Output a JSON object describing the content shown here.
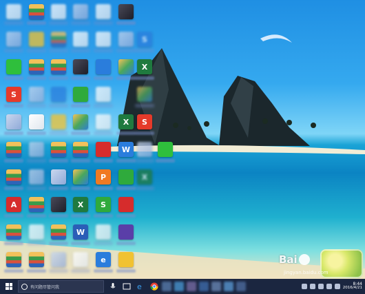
{
  "desktop": {
    "icons": [
      {
        "name": "doc-icon",
        "glyph": "",
        "style": "t-doc",
        "blur": true
      },
      {
        "name": "archive-icon",
        "glyph": "",
        "style": "t-rar",
        "blur": false
      },
      {
        "name": "document-icon",
        "glyph": "",
        "style": "t-doc",
        "blur": true
      },
      {
        "name": "chart-doc-icon",
        "glyph": "",
        "style": "t-pale",
        "blur": true
      },
      {
        "name": "file-icon",
        "glyph": "",
        "style": "t-doc",
        "blur": true
      },
      {
        "name": "dark-app-icon",
        "glyph": "",
        "style": "t-dark",
        "blur": false
      },
      {
        "name": "folder-icon",
        "glyph": "",
        "style": "t-pale",
        "blur": true
      },
      {
        "name": "document-icon",
        "glyph": "",
        "style": "t-yellow",
        "blur": true
      },
      {
        "name": "archive-icon",
        "glyph": "",
        "style": "t-rar",
        "blur": true
      },
      {
        "name": "document-icon",
        "glyph": "",
        "style": "t-doc",
        "blur": true
      },
      {
        "name": "document-icon",
        "glyph": "",
        "style": "t-doc",
        "blur": true
      },
      {
        "name": "app-icon",
        "glyph": "",
        "style": "t-pale",
        "blur": true
      },
      {
        "name": "app-icon",
        "glyph": "S",
        "style": "t-blue",
        "blur": true
      },
      {
        "name": "wechat-icon",
        "glyph": "",
        "style": "t-chat",
        "blur": false
      },
      {
        "name": "archive-icon",
        "glyph": "",
        "style": "t-rar",
        "blur": false
      },
      {
        "name": "archive-icon",
        "glyph": "",
        "style": "t-rar",
        "blur": false
      },
      {
        "name": "qq-icon",
        "glyph": "",
        "style": "t-dark",
        "blur": false
      },
      {
        "name": "phone-app-icon",
        "glyph": "",
        "style": "t-blue",
        "blur": false
      },
      {
        "name": "image-icon",
        "glyph": "",
        "style": "t-photo",
        "blur": false
      },
      {
        "name": "excel-icon",
        "glyph": "X",
        "style": "t-excel",
        "blur": false
      },
      {
        "name": "sogou-icon",
        "glyph": "S",
        "style": "t-sogou",
        "blur": false
      },
      {
        "name": "app-icon",
        "glyph": "",
        "style": "t-pale",
        "blur": true
      },
      {
        "name": "app-icon",
        "glyph": "",
        "style": "t-blue",
        "blur": true
      },
      {
        "name": "game-icon",
        "glyph": "",
        "style": "t-green",
        "blur": false
      },
      {
        "name": "document-icon",
        "glyph": "",
        "style": "t-doc",
        "blur": true
      },
      {
        "name": "image-icon",
        "glyph": "",
        "style": "t-photo",
        "blur": true
      },
      {
        "name": "app-icon",
        "glyph": "",
        "style": "t-pale",
        "blur": false
      },
      {
        "name": "document-icon",
        "glyph": "",
        "style": "t-doc",
        "blur": false
      },
      {
        "name": "folder-icon",
        "glyph": "",
        "style": "t-yellow",
        "blur": true
      },
      {
        "name": "photos-icon",
        "glyph": "",
        "style": "t-photo",
        "blur": false
      },
      {
        "name": "document-icon",
        "glyph": "",
        "style": "t-doc",
        "blur": true
      },
      {
        "name": "excel-icon",
        "glyph": "X",
        "style": "t-excel",
        "blur": false
      },
      {
        "name": "sogou-icon",
        "glyph": "S",
        "style": "t-sogou",
        "blur": false
      },
      {
        "name": "archive-icon",
        "glyph": "",
        "style": "t-rar",
        "blur": false
      },
      {
        "name": "app-icon",
        "glyph": "",
        "style": "t-pale",
        "blur": true
      },
      {
        "name": "archive-icon",
        "glyph": "",
        "style": "t-rar",
        "blur": false
      },
      {
        "name": "archive-icon",
        "glyph": "",
        "style": "t-rar",
        "blur": false
      },
      {
        "name": "red-app-icon",
        "glyph": "",
        "style": "t-red",
        "blur": false
      },
      {
        "name": "word-app-icon",
        "glyph": "W",
        "style": "t-blue",
        "blur": false
      },
      {
        "name": "app-icon",
        "glyph": "",
        "style": "t-pale",
        "blur": true
      },
      {
        "name": "wechat-icon",
        "glyph": "",
        "style": "t-chat",
        "blur": false
      },
      {
        "name": "archive-icon",
        "glyph": "",
        "style": "t-rar",
        "blur": false
      },
      {
        "name": "document-icon",
        "glyph": "",
        "style": "t-pale",
        "blur": true
      },
      {
        "name": "laptop-icon",
        "glyph": "",
        "style": "t-pale",
        "blur": false
      },
      {
        "name": "photos-icon",
        "glyph": "",
        "style": "t-photo",
        "blur": false
      },
      {
        "name": "wps-icon",
        "glyph": "P",
        "style": "t-orange",
        "blur": false
      },
      {
        "name": "app-icon",
        "glyph": "",
        "style": "t-green",
        "blur": false
      },
      {
        "name": "excel-icon",
        "glyph": "X",
        "style": "t-excel",
        "blur": true
      },
      {
        "name": "adobe-icon",
        "glyph": "A",
        "style": "t-red",
        "blur": false
      },
      {
        "name": "archive-icon",
        "glyph": "",
        "style": "t-rar",
        "blur": false
      },
      {
        "name": "monitor-icon",
        "glyph": "",
        "style": "t-dark",
        "blur": false
      },
      {
        "name": "excel-icon",
        "glyph": "X",
        "style": "t-excel",
        "blur": false
      },
      {
        "name": "wps-sheet-icon",
        "glyph": "S",
        "style": "t-green",
        "blur": false
      },
      {
        "name": "app-icon",
        "glyph": "",
        "style": "t-red",
        "blur": false
      },
      {
        "name": "archive-icon",
        "glyph": "",
        "style": "t-rar",
        "blur": false
      },
      {
        "name": "document-icon",
        "glyph": "",
        "style": "t-doc",
        "blur": true
      },
      {
        "name": "archive-icon",
        "glyph": "",
        "style": "t-rar",
        "blur": false
      },
      {
        "name": "word-icon",
        "glyph": "W",
        "style": "t-word",
        "blur": false
      },
      {
        "name": "document-icon",
        "glyph": "",
        "style": "t-doc",
        "blur": true
      },
      {
        "name": "visual-studio-icon",
        "glyph": "",
        "style": "t-purple",
        "blur": false
      },
      {
        "name": "archive-icon",
        "glyph": "",
        "style": "t-rar",
        "blur": false
      },
      {
        "name": "archive-icon",
        "glyph": "",
        "style": "t-rar",
        "blur": false
      },
      {
        "name": "app-icon",
        "glyph": "",
        "style": "t-pale",
        "blur": true
      },
      {
        "name": "document-icon",
        "glyph": "",
        "style": "t-doc",
        "blur": true
      },
      {
        "name": "ie-icon",
        "glyph": "e",
        "style": "t-blue",
        "blur": false
      },
      {
        "name": "app-icon",
        "glyph": "",
        "style": "t-yellow",
        "blur": false
      }
    ]
  },
  "watermark": {
    "text": "Bai",
    "sub": "jingyan.baidu.com"
  },
  "taskbar": {
    "search_placeholder": "有问题尽管问我",
    "time": "8:44",
    "date": "2016/4/21"
  }
}
